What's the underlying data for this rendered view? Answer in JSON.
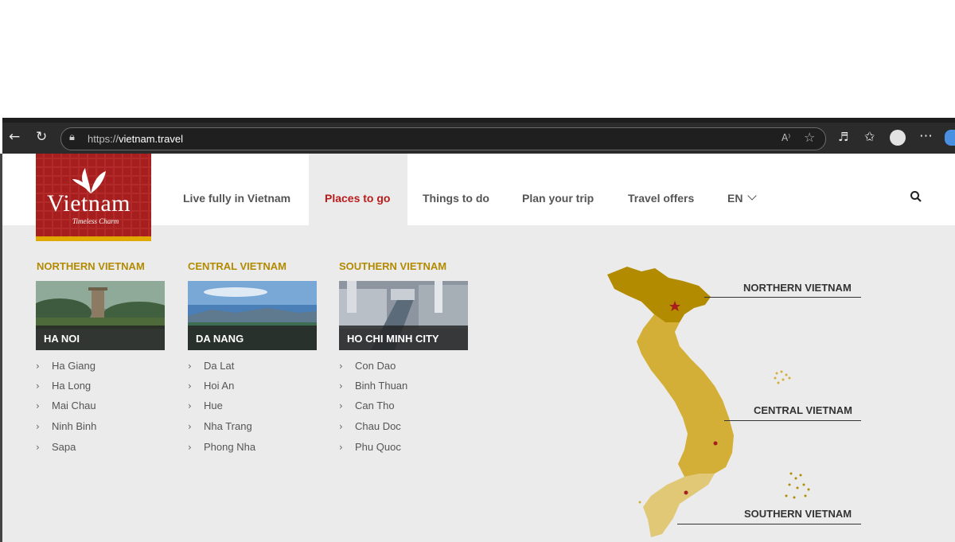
{
  "browser": {
    "url_scheme": "https://",
    "url_host": "vietnam.travel",
    "icons": [
      "back-icon",
      "refresh-icon",
      "lock-icon",
      "read-aloud-icon",
      "favorite-icon",
      "extension-icon",
      "favorites-icon",
      "profile-icon",
      "more-icon",
      "copilot-icon"
    ]
  },
  "logo": {
    "name": "Vietnam",
    "tagline": "Timeless Charm"
  },
  "nav": {
    "items": [
      "Live fully in Vietnam",
      "Places to go",
      "Things to do",
      "Plan your trip",
      "Travel offers"
    ],
    "active": "Places to go",
    "language": "EN"
  },
  "regions": [
    {
      "title": "NORTHERN VIETNAM",
      "featured": "HA NOI",
      "places": [
        "Ha Giang",
        "Ha Long",
        "Mai Chau",
        "Ninh Binh",
        "Sapa"
      ]
    },
    {
      "title": "CENTRAL VIETNAM",
      "featured": "DA NANG",
      "places": [
        "Da Lat",
        "Hoi An",
        "Hue",
        "Nha Trang",
        "Phong Nha"
      ]
    },
    {
      "title": "SOUTHERN VIETNAM",
      "featured": "HO CHI MINH CITY",
      "places": [
        "Con Dao",
        "Binh Thuan",
        "Can Tho",
        "Chau Doc",
        "Phu Quoc"
      ]
    }
  ],
  "map": {
    "labels": [
      "NORTHERN VIETNAM",
      "CENTRAL VIETNAM",
      "SOUTHERN VIETNAM"
    ],
    "colors": {
      "north": "#b38b00",
      "central": "#d4af37",
      "south": "#e0c877",
      "marker": "#a61e1e"
    }
  }
}
